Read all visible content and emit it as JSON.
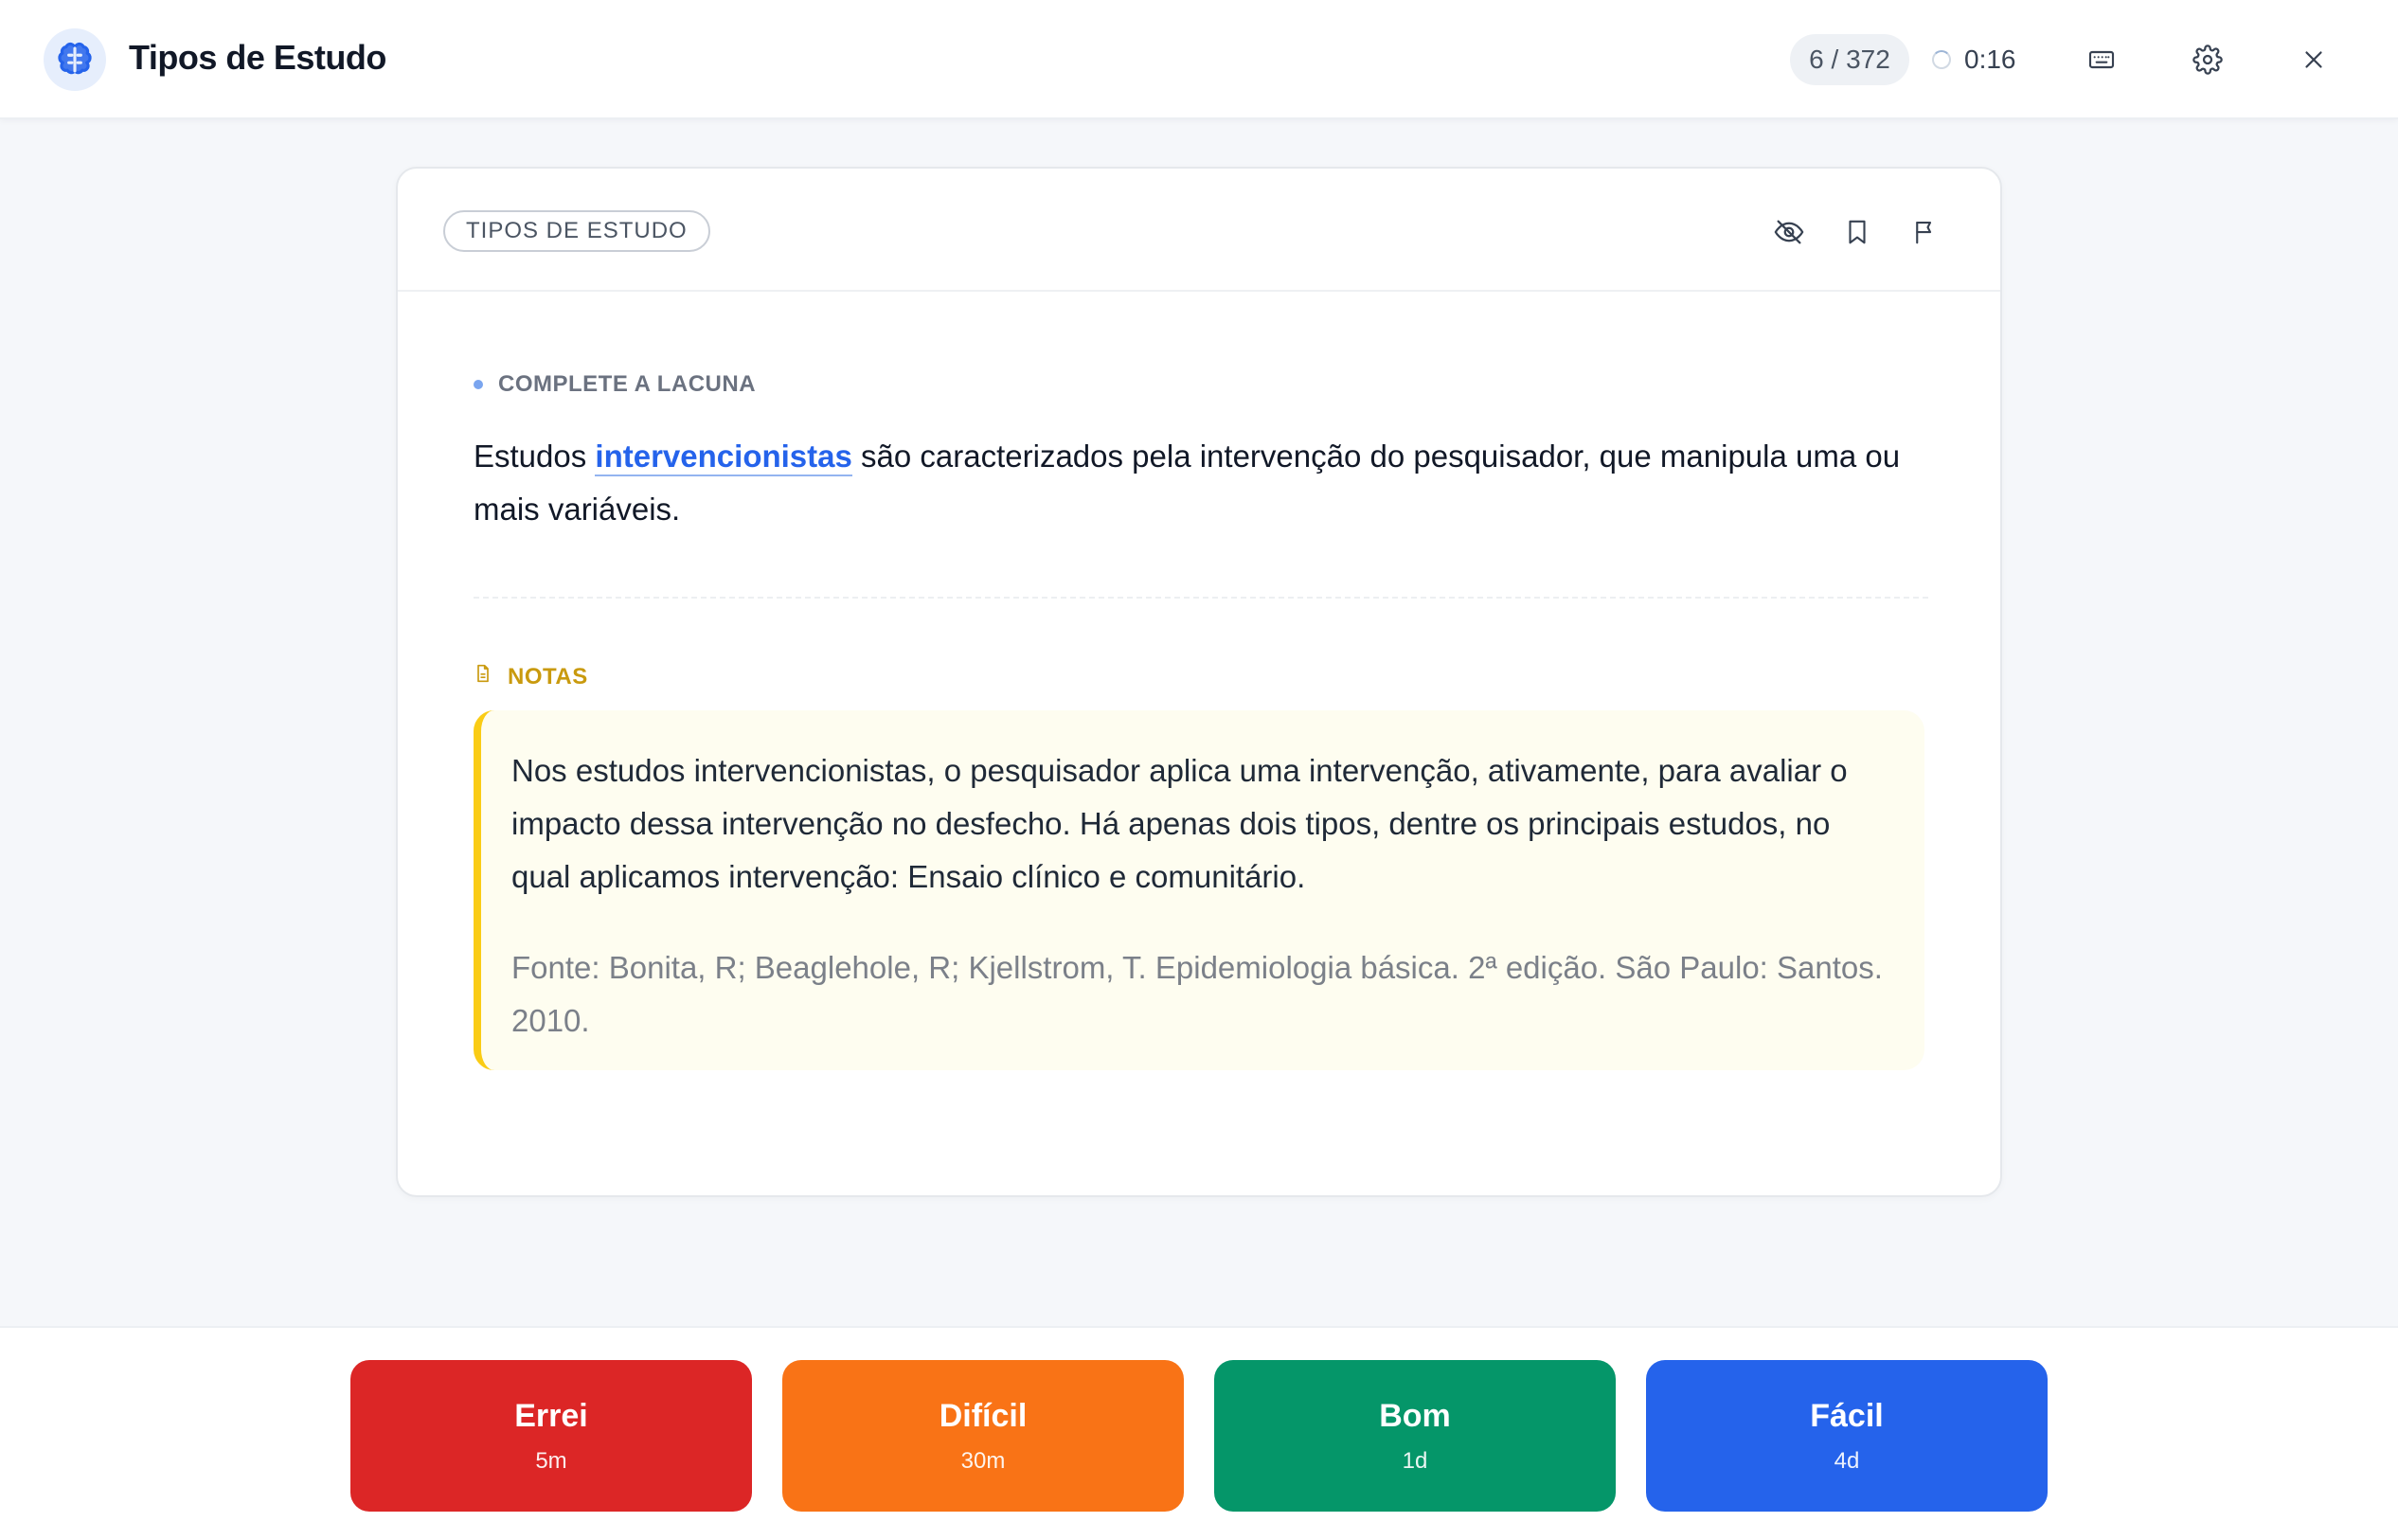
{
  "header": {
    "title": "Tipos de Estudo",
    "progress": "6 / 372",
    "timer": "0:16",
    "icons": [
      "brain-icon",
      "keyboard-icon",
      "gear-icon",
      "close-icon"
    ]
  },
  "card": {
    "tag": "TIPOS DE ESTUDO",
    "actions": [
      "hide-icon",
      "bookmark-icon",
      "flag-icon"
    ],
    "section_label": "COMPLETE A LACUNA",
    "question": {
      "before": "Estudos ",
      "cloze": "intervencionistas",
      "after": " são caracterizados pela intervenção do pesquisador, que manipula uma ou mais variáveis."
    },
    "notes_label": "NOTAS",
    "notes_text": "Nos estudos intervencionistas, o pesquisador aplica uma intervenção, ativamente, para avaliar o impacto dessa intervenção no desfecho. Há apenas dois tipos, dentre os principais estudos, no qual aplicamos intervenção: Ensaio clínico e comunitário.",
    "notes_source": "Fonte: Bonita, R; Beaglehole, R; Kjellstrom, T. Epidemiologia básica. 2ª edição. São Paulo: Santos. 2010."
  },
  "grades": [
    {
      "label": "Errei",
      "interval": "5m",
      "color": "#dc2626"
    },
    {
      "label": "Difícil",
      "interval": "30m",
      "color": "#f97316"
    },
    {
      "label": "Bom",
      "interval": "1d",
      "color": "#059669"
    },
    {
      "label": "Fácil",
      "interval": "4d",
      "color": "#2563eb"
    }
  ],
  "colors": {
    "accent": "#2563eb",
    "notes_accent": "#facc15",
    "notes_label": "#c99a0e"
  }
}
